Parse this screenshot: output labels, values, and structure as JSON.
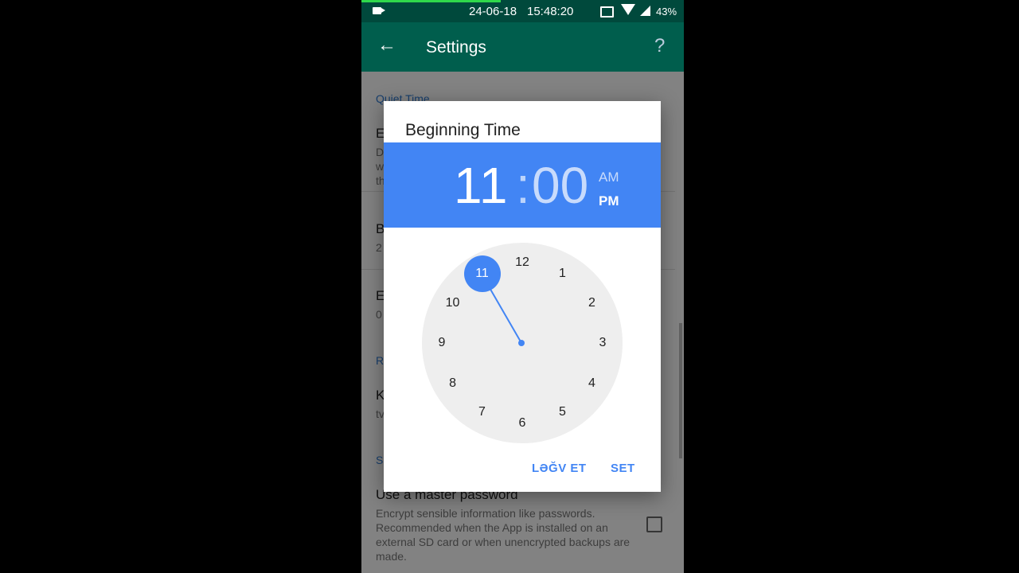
{
  "status_bar": {
    "date": "24-06-18",
    "time": "15:48:20",
    "battery": "43%",
    "icons": [
      "video-camera-icon",
      "cast-icon",
      "wifi-icon",
      "signal-icon"
    ]
  },
  "toolbar": {
    "title": "Settings",
    "back_icon": "arrow-left-icon",
    "help_icon": "question-mark-icon"
  },
  "settings": {
    "quiet_section": "Quiet Time",
    "item1_title": "E",
    "item1_sub": "D\nw\nth",
    "item2_title": "B",
    "item2_sub": "2",
    "item3_title": "E",
    "item3_sub": "0",
    "section2": "R",
    "item4_title": "K",
    "item4_sub": "tv",
    "section3": "S",
    "master_title": "Use a master password",
    "master_sub": "Encrypt sensible information like passwords. Recommended when the App is installed on an external SD card or when unencrypted backups are made."
  },
  "dialog": {
    "title": "Beginning Time",
    "hour": "11",
    "separator": ":",
    "minute": "00",
    "am": "AM",
    "pm": "PM",
    "selected_period": "PM",
    "selected_hour": 11,
    "clock_numbers": [
      "12",
      "1",
      "2",
      "3",
      "4",
      "5",
      "6",
      "7",
      "8",
      "9",
      "10",
      "11"
    ],
    "cancel": "LƏĞV ET",
    "set": "SET"
  },
  "colors": {
    "toolbar": "#005e4d",
    "status_bar": "#00493c",
    "accent": "#4285f4"
  }
}
